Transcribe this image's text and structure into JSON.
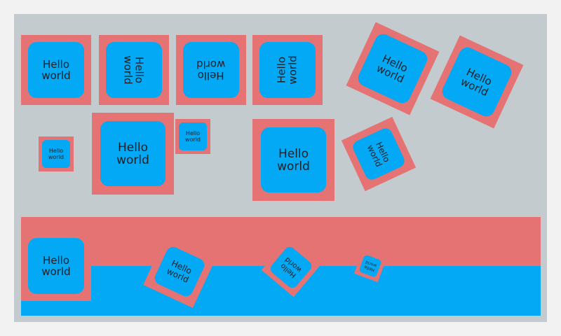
{
  "cards": [
    {
      "id": "row1-a",
      "text": "Hello\nworld"
    },
    {
      "id": "row1-b",
      "text": "Hello\nworld"
    },
    {
      "id": "row1-c",
      "text": "Hello\nworld"
    },
    {
      "id": "row1-d",
      "text": "Hello\nworld"
    },
    {
      "id": "rot-1",
      "text": "Hello\nworld"
    },
    {
      "id": "rot-2",
      "text": "Hello\nworld"
    },
    {
      "id": "small-1",
      "text": "Hello\nworld"
    },
    {
      "id": "large-1",
      "text": "Hello\nworld"
    },
    {
      "id": "small-2",
      "text": "Hello\nworld"
    },
    {
      "id": "large-2",
      "text": "Hello\nworld"
    },
    {
      "id": "rot-3",
      "text": "Hello\nworld"
    },
    {
      "id": "band-1",
      "text": "Hello\nworld"
    },
    {
      "id": "band-2",
      "text": "Hello\nworld"
    },
    {
      "id": "band-3",
      "text": "Hello\nworld"
    },
    {
      "id": "band-4",
      "text": "Hello\nworld"
    }
  ],
  "colors": {
    "background": "#c4cbcf",
    "outer": "#e57373",
    "inner": "#03a9f4",
    "text": "#1e1e24"
  }
}
